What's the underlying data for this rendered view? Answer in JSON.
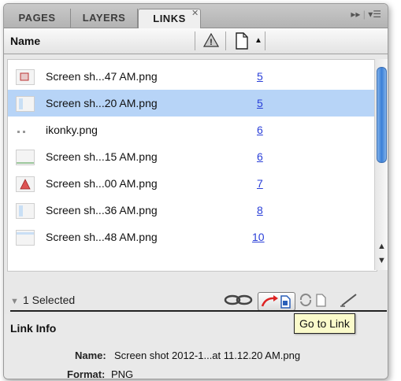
{
  "tabs": [
    "PAGES",
    "LAYERS",
    "LINKS"
  ],
  "active_tab": "LINKS",
  "header": {
    "name_label": "Name"
  },
  "files": [
    {
      "name": "Screen sh...47 AM.png",
      "page": "5"
    },
    {
      "name": "Screen sh...20 AM.png",
      "page": "5",
      "selected": true
    },
    {
      "name": "ikonky.png",
      "page": "6"
    },
    {
      "name": "Screen sh...15 AM.png",
      "page": "6"
    },
    {
      "name": "Screen sh...00 AM.png",
      "page": "7"
    },
    {
      "name": "Screen sh...36 AM.png",
      "page": "8"
    },
    {
      "name": "Screen sh...48 AM.png",
      "page": "10"
    }
  ],
  "status": {
    "selected_text": "1 Selected"
  },
  "link_info": {
    "title": "Link Info",
    "name_label": "Name:",
    "name_value": "Screen shot 2012-1...at 11.12.20 AM.png",
    "format_label": "Format:",
    "format_value": "PNG"
  },
  "tooltip": "Go to Link",
  "colors": {
    "selection": "#b7d4f7",
    "link_blue": "#2a3fd8",
    "scroll_thumb": "#3a7fd6",
    "tooltip_bg": "#fbfbcb"
  }
}
